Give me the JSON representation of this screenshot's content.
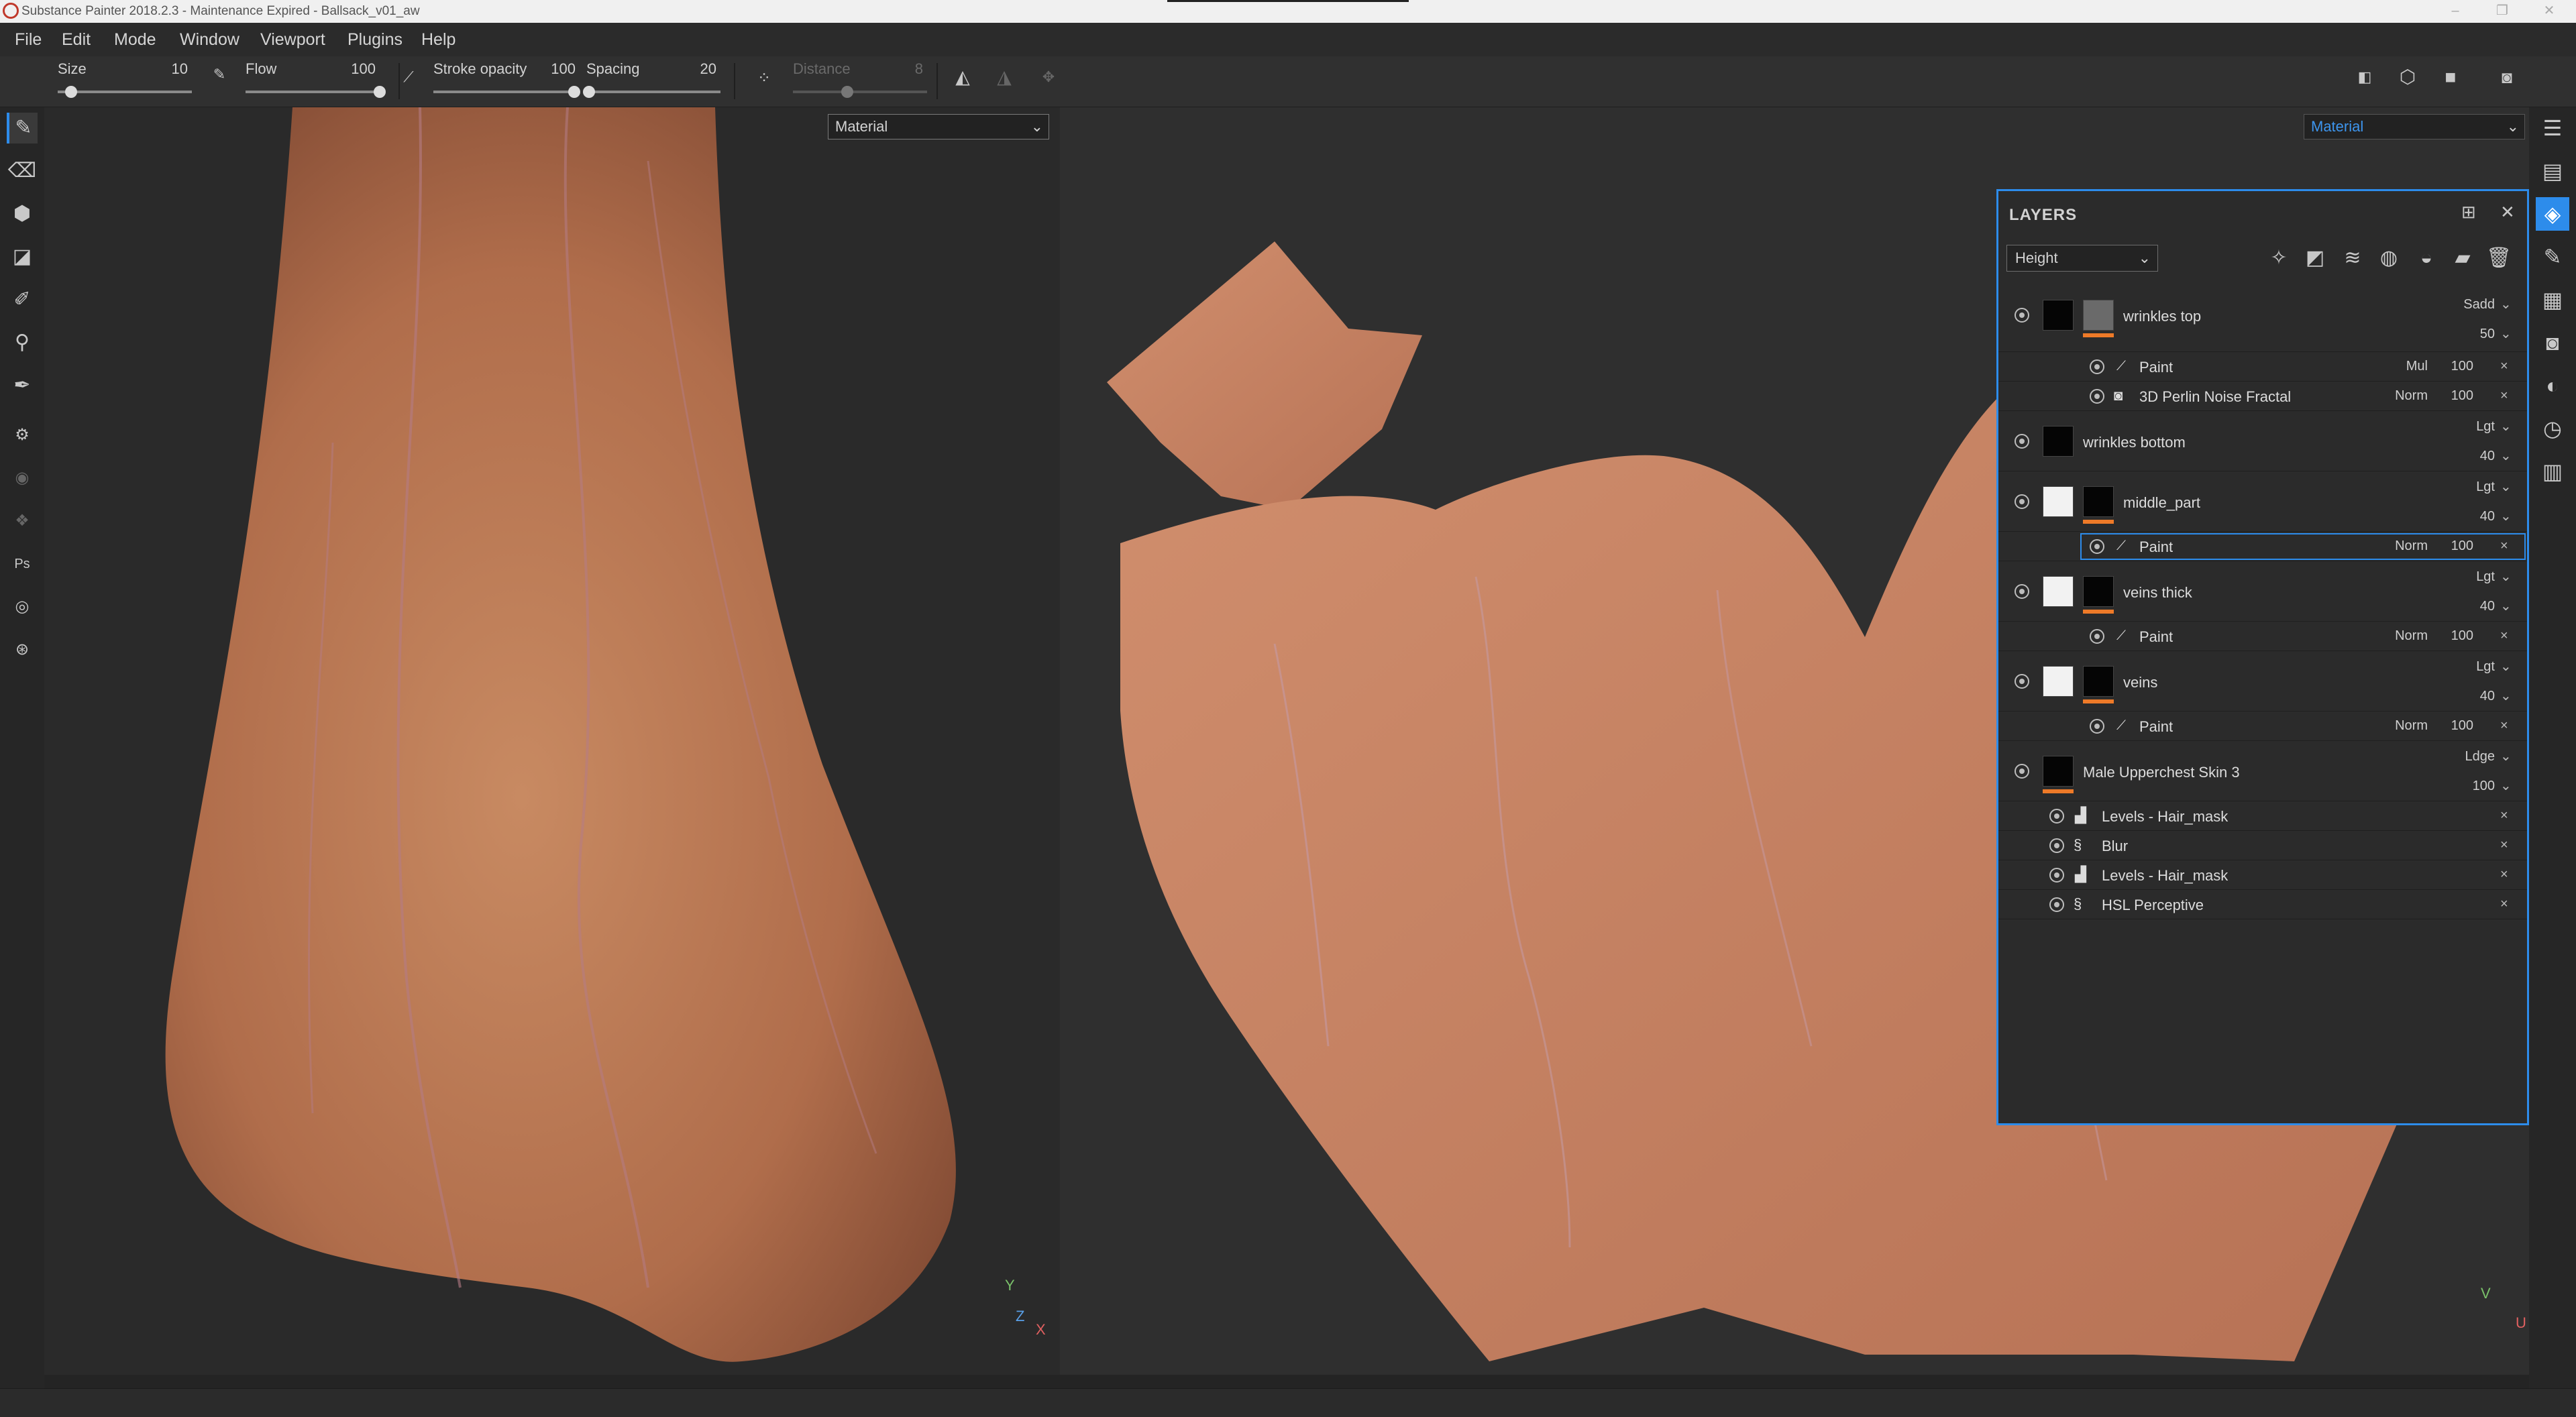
{
  "window": {
    "title": "Substance Painter 2018.2.3 - Maintenance Expired - Ballsack_v01_aw",
    "min": "–",
    "max": "❐",
    "close": "✕"
  },
  "menu": [
    "File",
    "Edit",
    "Mode",
    "Window",
    "Viewport",
    "Plugins",
    "Help"
  ],
  "toolbar": {
    "size_label": "Size",
    "size_value": "10",
    "size_level": 0.1,
    "flow_label": "Flow",
    "flow_value": "100",
    "flow_level": 1.0,
    "stroke_label": "Stroke opacity",
    "stroke_value": "100",
    "stroke_level": 1.0,
    "spacing_label": "Spacing",
    "spacing_value": "20",
    "spacing_level": 0.02,
    "distance_label": "Distance",
    "distance_value": "8"
  },
  "viewport3d": {
    "material_select": "Material",
    "axis_y": "Y",
    "axis_z": "Z",
    "axis_x": "X"
  },
  "viewport2d": {
    "material_select": "Material",
    "axis_v": "V",
    "axis_u": "U"
  },
  "layers": {
    "title": "LAYERS",
    "channel": "Height",
    "rows": [
      {
        "name": "wrinkles top",
        "blend": "Sadd",
        "opacity": "50"
      },
      {
        "name": "Paint",
        "blend": "Mul",
        "opacity": "100"
      },
      {
        "name": "3D Perlin Noise Fractal",
        "blend": "Norm",
        "opacity": "100"
      },
      {
        "name": "wrinkles bottom",
        "blend": "Lgt",
        "opacity": "40"
      },
      {
        "name": "middle_part",
        "blend": "Lgt",
        "opacity": "40"
      },
      {
        "name": "Paint",
        "blend": "Norm",
        "opacity": "100"
      },
      {
        "name": "veins thick",
        "blend": "Lgt",
        "opacity": "40"
      },
      {
        "name": "Paint",
        "blend": "Norm",
        "opacity": "100"
      },
      {
        "name": "veins",
        "blend": "Lgt",
        "opacity": "40"
      },
      {
        "name": "Paint",
        "blend": "Norm",
        "opacity": "100"
      },
      {
        "name": "Male Upperchest Skin 3",
        "blend": "Ldge",
        "opacity": "100"
      },
      {
        "name": "Levels - Hair_mask"
      },
      {
        "name": "Blur"
      },
      {
        "name": "Levels - Hair_mask"
      },
      {
        "name": "HSL Perceptive"
      }
    ]
  },
  "colors": {
    "accent": "#2d8ceb",
    "skin": "#c07a56",
    "mask_bar": "#ee7a28"
  }
}
